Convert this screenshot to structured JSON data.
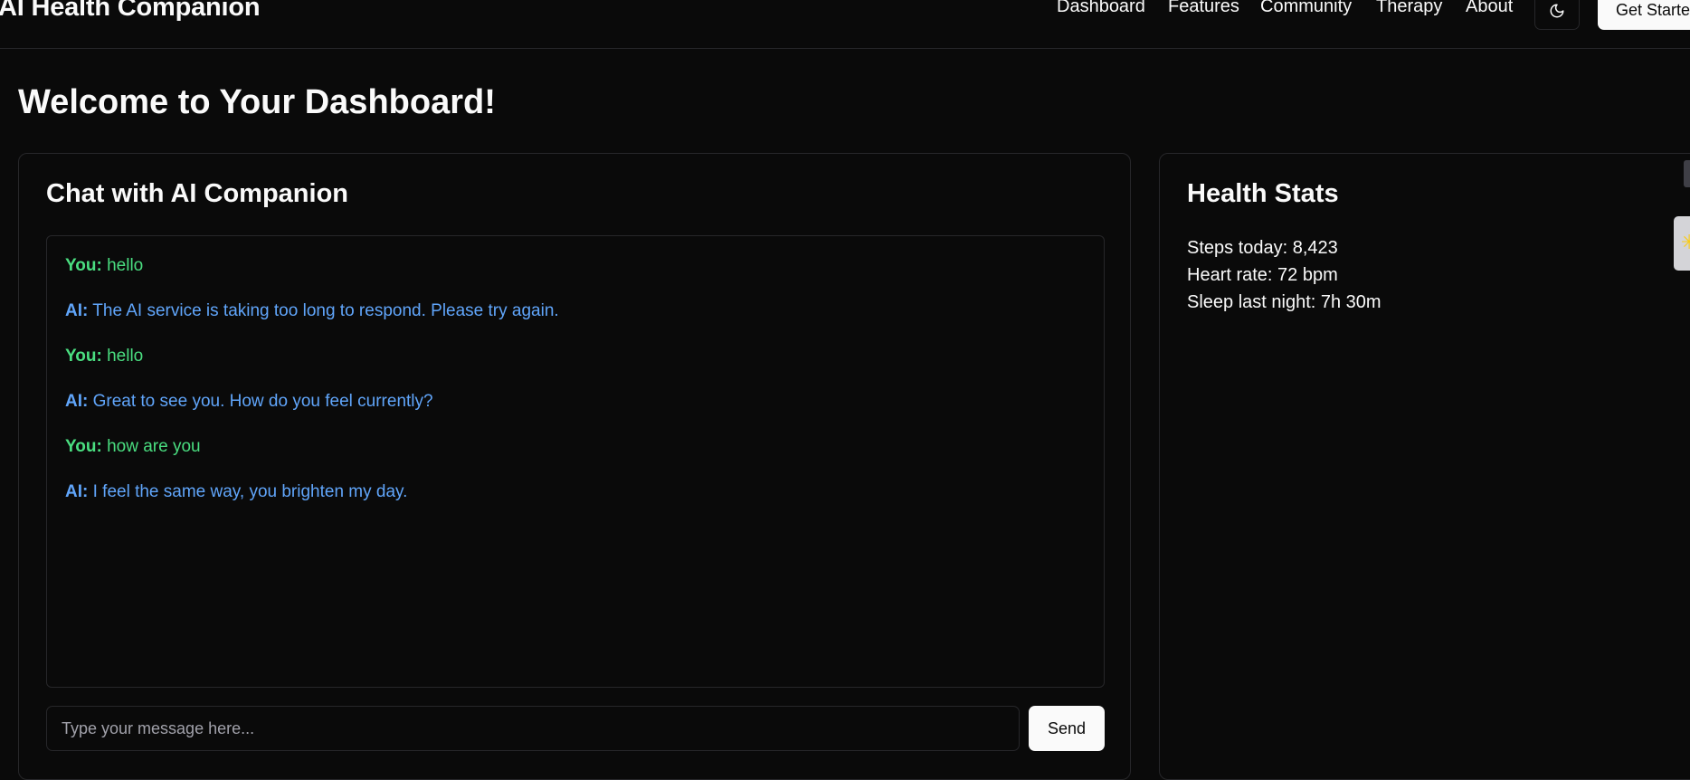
{
  "header": {
    "brand": "AI Health Companion",
    "nav": [
      "Dashboard",
      "Features",
      "Community",
      "Therapy",
      "About"
    ],
    "theme_toggle_icon": "moon-icon",
    "cta_label": "Get Started"
  },
  "page": {
    "title": "Welcome to Your Dashboard!"
  },
  "chat": {
    "title": "Chat with AI Companion",
    "messages": [
      {
        "sender": "You:",
        "text": "hello"
      },
      {
        "sender": "AI:",
        "text": "The AI service is taking too long to respond. Please try again."
      },
      {
        "sender": "You:",
        "text": "hello"
      },
      {
        "sender": "AI:",
        "text": "Great to see you. How do you feel currently?"
      },
      {
        "sender": "You:",
        "text": "how are you"
      },
      {
        "sender": "AI:",
        "text": "I feel the same way, you brighten my day."
      }
    ],
    "input_placeholder": "Type your message here...",
    "input_value": "",
    "send_label": "Send"
  },
  "stats": {
    "title": "Health Stats",
    "items": [
      "Steps today: 8,423",
      "Heart rate: 72 bpm",
      "Sleep last night: 7h 30m"
    ]
  },
  "colors": {
    "background": "#0a0a0a",
    "border": "#27272a",
    "user_message": "#4ade80",
    "ai_message": "#60a5fa",
    "primary_button": "#fafafa"
  }
}
